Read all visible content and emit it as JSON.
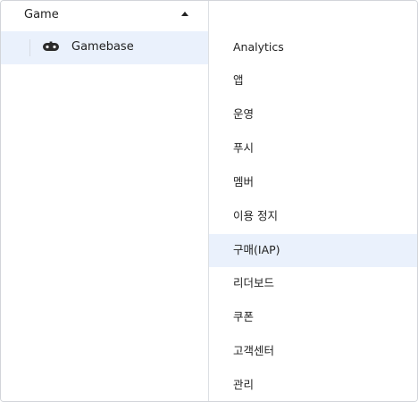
{
  "left_panel": {
    "group_title": "Game",
    "group_expanded": true,
    "service": {
      "label": "Gamebase",
      "icon": "gamepad-icon",
      "selected": true
    }
  },
  "right_panel": {
    "selected_index": 6,
    "items": [
      {
        "label": "Analytics"
      },
      {
        "label": "앱"
      },
      {
        "label": "운영"
      },
      {
        "label": "푸시"
      },
      {
        "label": "멤버"
      },
      {
        "label": "이용 정지"
      },
      {
        "label": "구매(IAP)"
      },
      {
        "label": "리더보드"
      },
      {
        "label": "쿠폰"
      },
      {
        "label": "고객센터"
      },
      {
        "label": "관리"
      }
    ]
  },
  "colors": {
    "selected_background": "#eaf1fc",
    "border": "#d2d5da",
    "text": "#222222"
  }
}
